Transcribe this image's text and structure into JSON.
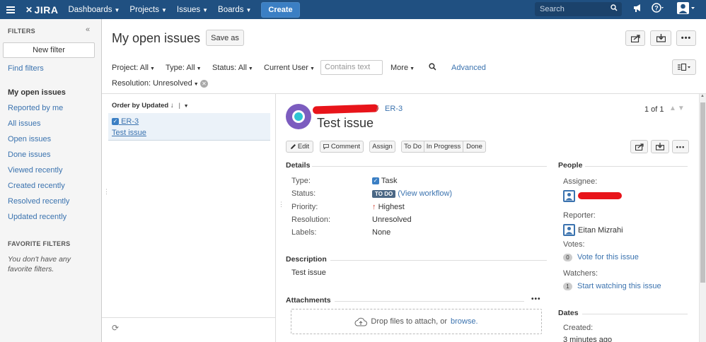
{
  "topnav": {
    "logo_text": "JIRA",
    "items": [
      {
        "label": "Dashboards"
      },
      {
        "label": "Projects"
      },
      {
        "label": "Issues"
      },
      {
        "label": "Boards"
      }
    ],
    "create_label": "Create",
    "search_placeholder": "Search",
    "icons": [
      "menu-icon",
      "jira-logo-icon",
      "search-icon",
      "megaphone-icon",
      "help-icon",
      "user-icon"
    ]
  },
  "sidebar": {
    "header": "FILTERS",
    "new_filter_label": "New filter",
    "find_filters": "Find filters",
    "items": [
      {
        "label": "My open issues",
        "active": true
      },
      {
        "label": "Reported by me"
      },
      {
        "label": "All issues"
      },
      {
        "label": "Open issues"
      },
      {
        "label": "Done issues"
      },
      {
        "label": "Viewed recently"
      },
      {
        "label": "Created recently"
      },
      {
        "label": "Resolved recently"
      },
      {
        "label": "Updated recently"
      }
    ],
    "favorites_header": "FAVORITE FILTERS",
    "favorites_note": "You don't have any favorite filters."
  },
  "main": {
    "title": "My open issues",
    "save_as_label": "Save as",
    "filters": {
      "project": "Project: All",
      "type": "Type: All",
      "status": "Status: All",
      "assignee": "Current User",
      "contains_placeholder": "Contains text",
      "more": "More",
      "advanced": "Advanced",
      "resolution": "Resolution: Unresolved"
    }
  },
  "list": {
    "order_by": "Order by Updated",
    "issues": [
      {
        "key": "ER-3",
        "summary": "Test issue"
      }
    ]
  },
  "detail": {
    "breadcrumb_sep": "/",
    "key": "ER-3",
    "title": "Test issue",
    "pager": "1 of 1",
    "ops": [
      "Edit",
      "Comment",
      "Assign",
      "To Do",
      "In Progress",
      "Done"
    ],
    "details_header": "Details",
    "fields": {
      "type_label": "Type:",
      "type_value": "Task",
      "status_label": "Status:",
      "status_value": "TO DO",
      "workflow_link": "(View workflow)",
      "priority_label": "Priority:",
      "priority_value": "Highest",
      "resolution_label": "Resolution:",
      "resolution_value": "Unresolved",
      "labels_label": "Labels:",
      "labels_value": "None"
    },
    "description_header": "Description",
    "description": "Test issue",
    "attachments_header": "Attachments",
    "drop_text": "Drop files to attach, or",
    "browse_link": "browse."
  },
  "people": {
    "header": "People",
    "assignee_label": "Assignee:",
    "reporter_label": "Reporter:",
    "reporter_name": "Eitan Mizrahi",
    "votes_label": "Votes:",
    "votes_count": "0",
    "vote_link": "Vote for this issue",
    "watchers_label": "Watchers:",
    "watchers_count": "1",
    "watch_link": "Start watching this issue",
    "dates_header": "Dates",
    "created_label": "Created:",
    "created_value": "3 minutes ago"
  },
  "colors": {
    "nav_bg": "#205081",
    "link": "#3b73af",
    "todo": "#4a6785",
    "priority_highest": "#d04437",
    "redaction": "#e8141a"
  }
}
